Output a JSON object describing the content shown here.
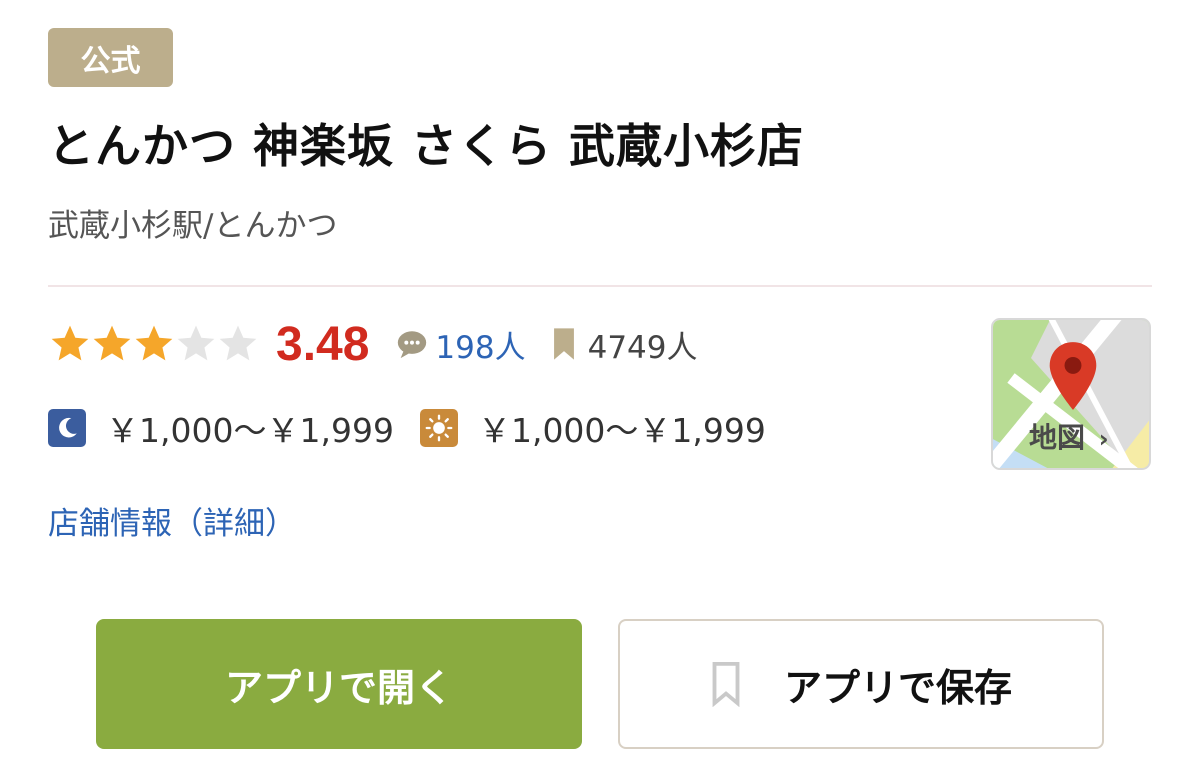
{
  "shop": {
    "badge": "公式",
    "name": "とんかつ 神楽坂 さくら 武蔵小杉店",
    "area_genre": "武蔵小杉駅/とんかつ"
  },
  "rating": {
    "score": "3.48",
    "stars_filled": 3,
    "stars_total": 5,
    "reviews": "198人",
    "saves": "4749人"
  },
  "prices": {
    "dinner": "￥1,000～￥1,999",
    "lunch": "￥1,000～￥1,999"
  },
  "links": {
    "detail": "店舗情報（詳細）",
    "map": "地図"
  },
  "buttons": {
    "open_app": "アプリで開く",
    "save_app": "アプリで保存"
  },
  "colors": {
    "star": "#f5a62a",
    "score": "#d12b1f",
    "link": "#2d64b5",
    "open_button": "#8aab40",
    "badge": "#bcae8c"
  },
  "icons": [
    "star-icon",
    "comment-icon",
    "bookmark-icon",
    "moon-icon",
    "sun-icon",
    "map-pin-icon",
    "chevron-right-icon"
  ]
}
